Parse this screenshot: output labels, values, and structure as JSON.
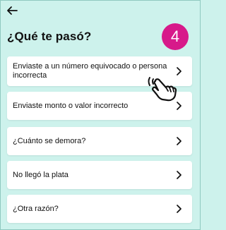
{
  "header": {
    "back_icon": "arrow-left-icon",
    "title": "¿Qué te pasó?"
  },
  "step_badge": {
    "number": "4",
    "color": "#d71a8a"
  },
  "options": [
    {
      "label": "Enviaste a un número equivocado o persona incorrecta",
      "icon": "chevron-right-icon"
    },
    {
      "label": "Enviaste monto o valor incorrecto",
      "icon": "chevron-right-icon"
    },
    {
      "label": "¿Cuánto se demora?",
      "icon": "chevron-right-icon"
    },
    {
      "label": "No llegó la plata",
      "icon": "chevron-right-icon"
    },
    {
      "label": "¿Otra razón?",
      "icon": "chevron-right-icon"
    }
  ],
  "pointer": {
    "icon": "hand-pointer-icon"
  },
  "colors": {
    "background": "#cdf2ec",
    "card": "#ffffff",
    "text": "#111111"
  }
}
